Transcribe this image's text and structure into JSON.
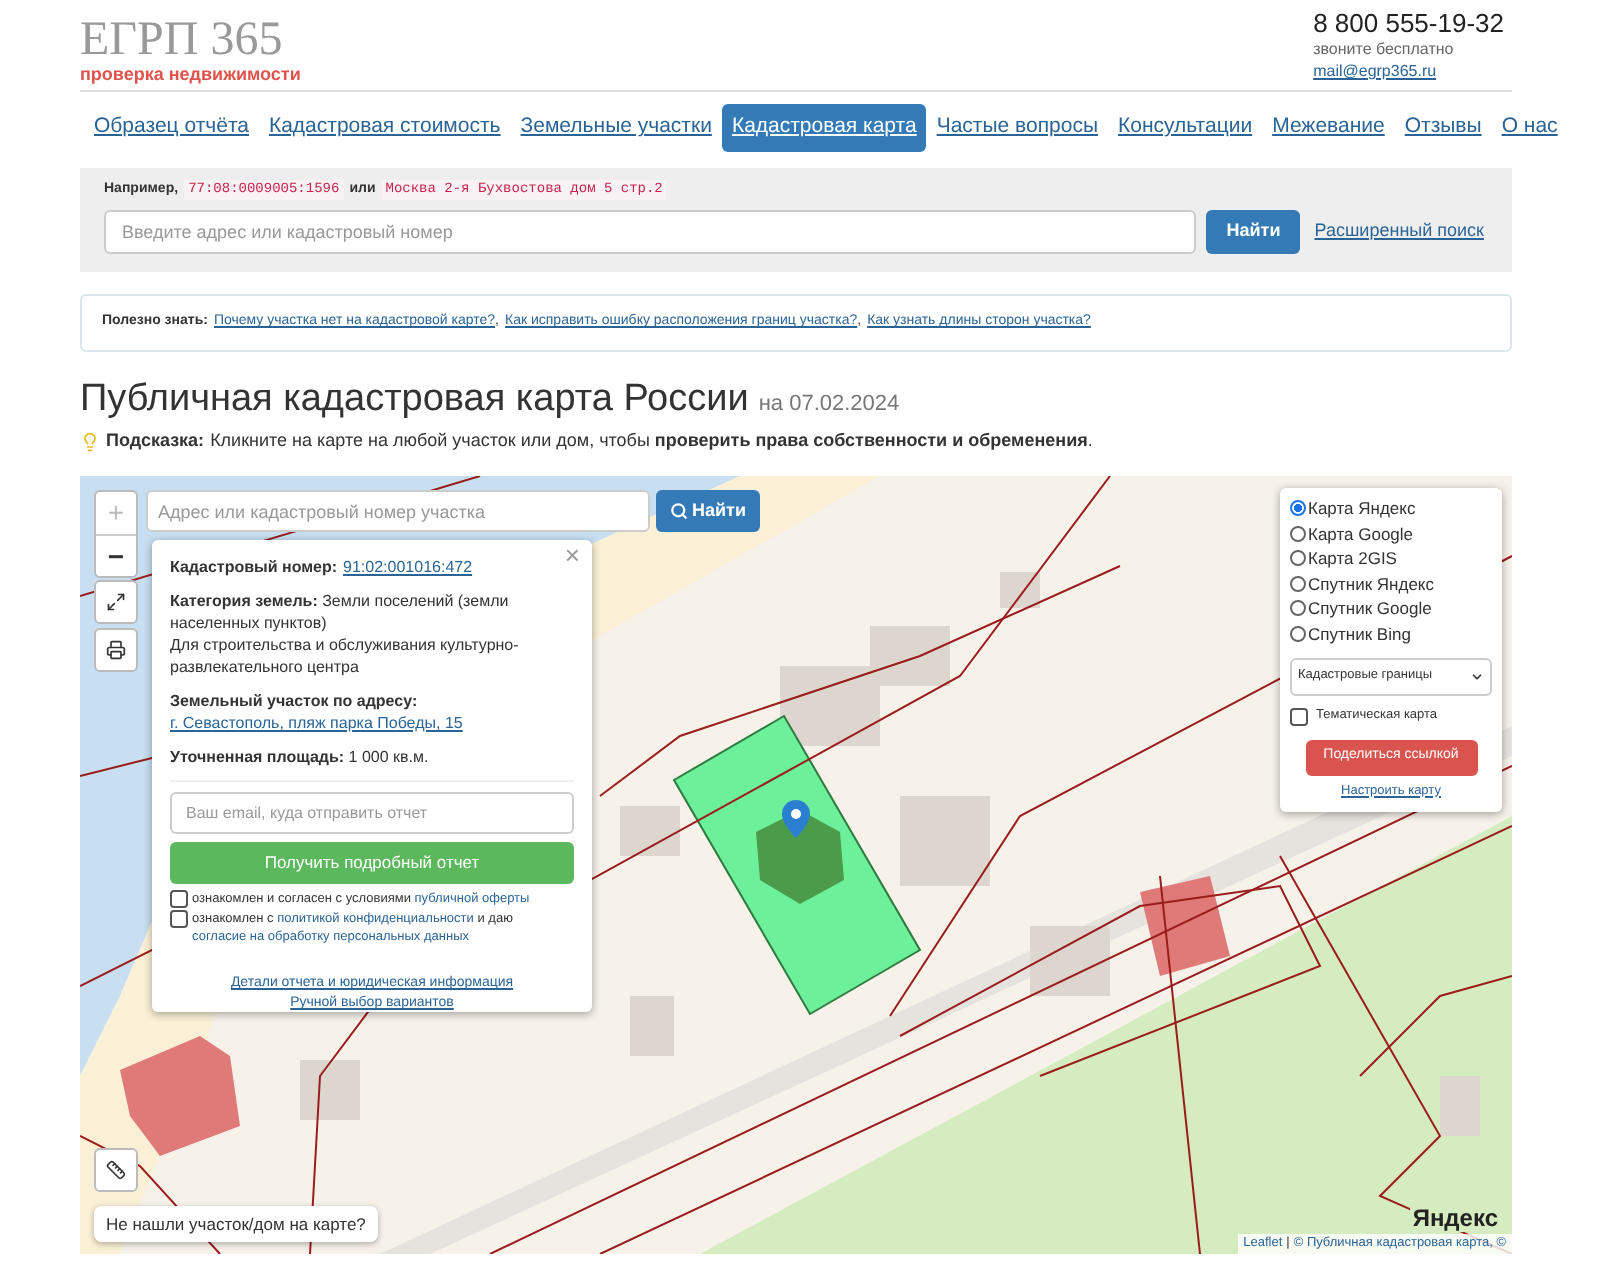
{
  "header": {
    "logo_title": "ЕГРП 365",
    "logo_subtitle": "проверка недвижимости",
    "phone": "8 800 555-19-32",
    "phone_note": "звоните бесплатно",
    "email": "mail@egrp365.ru"
  },
  "nav": [
    {
      "label": "Образец отчёта",
      "selected": false
    },
    {
      "label": "Кадастровая стоимость",
      "selected": false
    },
    {
      "label": "Земельные участки",
      "selected": false
    },
    {
      "label": "Кадастровая карта",
      "selected": true
    },
    {
      "label": "Частые вопросы",
      "selected": false
    },
    {
      "label": "Консультации",
      "selected": false
    },
    {
      "label": "Межевание",
      "selected": false
    },
    {
      "label": "Отзывы",
      "selected": false
    },
    {
      "label": "О нас",
      "selected": false
    }
  ],
  "search": {
    "example_label": "Например,",
    "example_1": "77:08:0009005:1596",
    "example_or": "или",
    "example_2": "Москва 2-я Бухвостова дом 5 стр.2",
    "placeholder": "Введите адрес или кадастровый номер",
    "button": "Найти",
    "advanced_link": "Расширенный поиск"
  },
  "useful": {
    "label": "Полезно знать:",
    "separator": ",",
    "links": [
      "Почему участка нет на кадастровой карте?",
      "Как исправить ошибку расположения границ участка?",
      "Как узнать длины сторон участка?"
    ]
  },
  "heading": {
    "title": "Публичная кадастровая карта России",
    "date": "на 07.02.2024"
  },
  "hint": {
    "label": "Подсказка:",
    "text": "Кликните на карте на любой участок или дом, чтобы **проверить права собственности и обременения**."
  },
  "map": {
    "zoom_in": "+",
    "zoom_out": "−",
    "search_placeholder": "Адрес или кадастровый номер участка",
    "search_button": "Найти",
    "popup": {
      "close": "×",
      "number_label": "Кадастровый номер:",
      "number": "91:02:001016:472",
      "category_label": "Категория земель:",
      "category": "Земли поселений (земли населенных пунктов)",
      "purpose": "Для строительства и обслуживания культурно-развлекательного центра",
      "address_label": "Земельный участок по адресу:",
      "address": "г. Севастополь, пляж парка Победы, 15",
      "area_label": "Уточненная площадь:",
      "area": "1 000 кв.м.",
      "email_placeholder": "Ваш email, куда отправить отчет",
      "submit": "Получить подробный отчет",
      "agreements": [
        {
          "checked": false,
          "parts": [
            {
              "text": "ознакомлен и согласен с условиями",
              "link": false
            },
            {
              "text": "публичной оферты",
              "link": true
            }
          ]
        },
        {
          "checked": false,
          "parts": [
            {
              "text": "ознакомлен с",
              "link": false
            },
            {
              "text": "политикой конфиденциальности",
              "link": true
            },
            {
              "text": "и даю",
              "link": false
            },
            {
              "text": "согласие на обработку персональных данных",
              "link": true
            }
          ]
        }
      ],
      "footer_links": [
        "Детали отчета и юридическая информация",
        "Ручной выбор вариантов"
      ]
    },
    "layers": {
      "options": [
        {
          "label": "Карта Яндекс",
          "selected": true
        },
        {
          "label": "Карта Google",
          "selected": false
        },
        {
          "label": "Карта 2GIS",
          "selected": false
        },
        {
          "label": "Спутник Яндекс",
          "selected": false
        },
        {
          "label": "Спутник Google",
          "selected": false
        },
        {
          "label": "Спутник Bing",
          "selected": false
        }
      ],
      "select_value": "Кадастровые границы",
      "thematic": {
        "label": "Тематическая карта",
        "checked": false
      },
      "share_button": "Поделиться ссылкой",
      "settings_link": "Настроить карту"
    },
    "not_found": "Не нашли участок/дом на карте?",
    "logo": "Яндекс",
    "attribution": {
      "leaflet": "Leaflet",
      "separator": "|",
      "text": "© Публичная кадастровая карта, ©"
    }
  }
}
